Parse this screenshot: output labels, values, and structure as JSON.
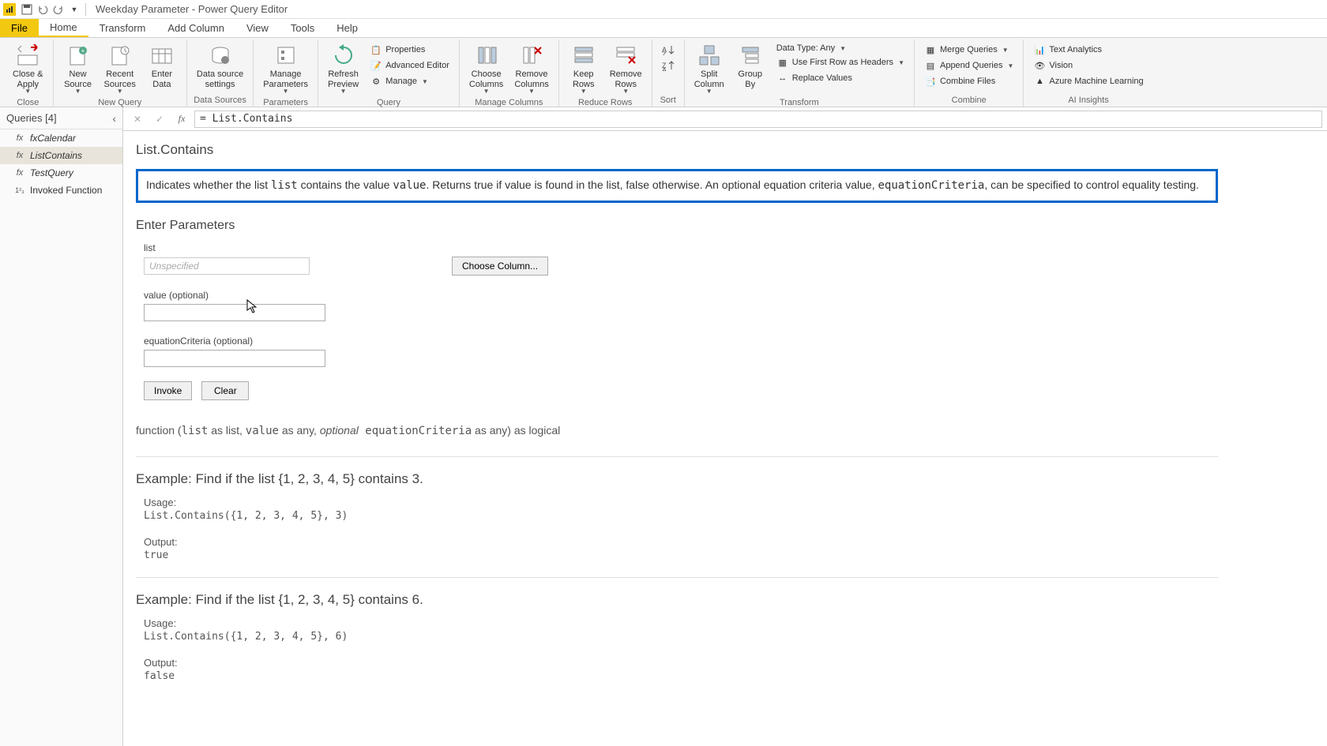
{
  "title": "Weekday Parameter - Power Query Editor",
  "tabs": {
    "file": "File",
    "home": "Home",
    "transform": "Transform",
    "addcolumn": "Add Column",
    "view": "View",
    "tools": "Tools",
    "help": "Help"
  },
  "ribbon": {
    "close_apply": "Close &\nApply",
    "close_group": "Close",
    "new_source": "New\nSource",
    "recent_sources": "Recent\nSources",
    "enter_data": "Enter\nData",
    "new_query_group": "New Query",
    "data_source_settings": "Data source\nsettings",
    "data_sources_group": "Data Sources",
    "manage_parameters": "Manage\nParameters",
    "parameters_group": "Parameters",
    "refresh_preview": "Refresh\nPreview",
    "properties": "Properties",
    "advanced_editor": "Advanced Editor",
    "manage": "Manage",
    "query_group": "Query",
    "choose_columns": "Choose\nColumns",
    "remove_columns": "Remove\nColumns",
    "manage_columns_group": "Manage Columns",
    "keep_rows": "Keep\nRows",
    "remove_rows": "Remove\nRows",
    "reduce_rows_group": "Reduce Rows",
    "sort_group": "Sort",
    "split_column": "Split\nColumn",
    "group_by": "Group\nBy",
    "data_type": "Data Type: Any",
    "first_row_headers": "Use First Row as Headers",
    "replace_values": "Replace Values",
    "transform_group": "Transform",
    "merge_queries": "Merge Queries",
    "append_queries": "Append Queries",
    "combine_files": "Combine Files",
    "combine_group": "Combine",
    "text_analytics": "Text Analytics",
    "vision": "Vision",
    "azure_ml": "Azure Machine Learning",
    "ai_insights_group": "AI Insights"
  },
  "queries": {
    "header": "Queries [4]",
    "items": [
      {
        "name": "fxCalendar",
        "icon": "fx"
      },
      {
        "name": "ListContains",
        "icon": "fx"
      },
      {
        "name": "TestQuery",
        "icon": "fx"
      },
      {
        "name": "Invoked Function",
        "icon": "123"
      }
    ]
  },
  "formula": "= List.Contains",
  "fn": {
    "title": "List.Contains",
    "desc_pre": "Indicates whether the list ",
    "desc_list": "list",
    "desc_mid1": " contains the value ",
    "desc_value": "value",
    "desc_mid2": ". Returns true if value is found in the list, false otherwise. An optional equation criteria value, ",
    "desc_eq": "equationCriteria",
    "desc_post": ", can be specified to control equality testing.",
    "enter_params": "Enter Parameters",
    "p_list": "list",
    "p_list_ph": "Unspecified",
    "choose_column": "Choose Column...",
    "p_value": "value (optional)",
    "p_eq": "equationCriteria (optional)",
    "invoke": "Invoke",
    "clear": "Clear",
    "sig_pre": "function (",
    "sig_list": "list",
    "sig_mid1": " as list, ",
    "sig_value": "value",
    "sig_mid2": " as any, ",
    "sig_opt": "optional",
    "sig_eq": " equationCriteria",
    "sig_post": " as any) as logical",
    "ex1_title": "Example: Find if the list {1, 2, 3, 4, 5} contains 3.",
    "ex1_usage_label": "Usage:",
    "ex1_usage": "List.Contains({1, 2, 3, 4, 5}, 3)",
    "ex1_output_label": "Output:",
    "ex1_output": "true",
    "ex2_title": "Example: Find if the list {1, 2, 3, 4, 5} contains 6.",
    "ex2_usage_label": "Usage:",
    "ex2_usage": "List.Contains({1, 2, 3, 4, 5}, 6)",
    "ex2_output_label": "Output:",
    "ex2_output": "false"
  }
}
